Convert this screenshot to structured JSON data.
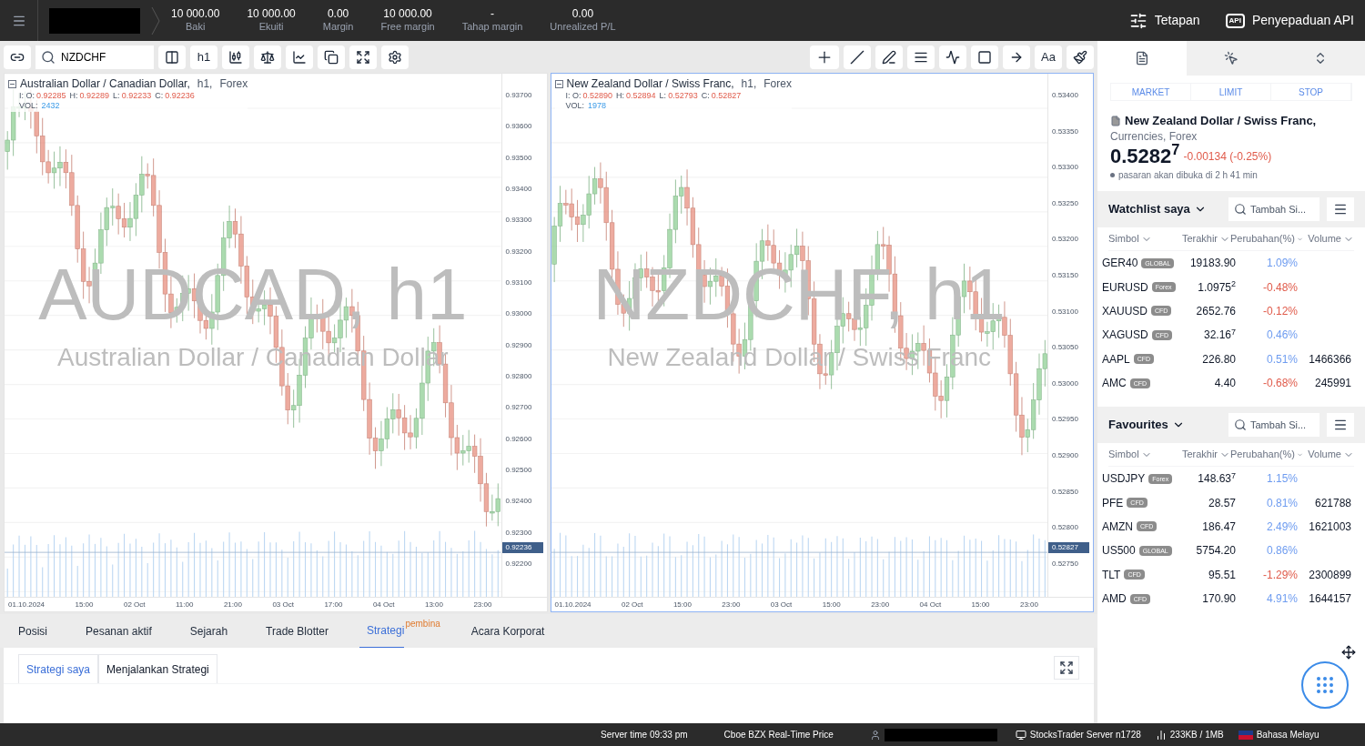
{
  "top_bar": {
    "stats": [
      {
        "value": "10 000.00",
        "label": "Baki"
      },
      {
        "value": "10 000.00",
        "label": "Ekuiti"
      },
      {
        "value": "0.00",
        "label": "Margin"
      },
      {
        "value": "10 000.00",
        "label": "Free margin"
      },
      {
        "value": "-",
        "label": "Tahap margin"
      },
      {
        "value": "0.00",
        "label": "Unrealized P/L"
      }
    ],
    "settings": "Tetapan",
    "api_badge": "API",
    "api": "Penyepaduan API"
  },
  "toolbar": {
    "symbol": "NZDCHF",
    "timeframe": "h1",
    "text_tool": "Aa"
  },
  "charts": [
    {
      "selected": false,
      "title": "Australian Dollar / Canadian Dollar,",
      "meta": [
        "h1,",
        "Forex"
      ],
      "ohlc": [
        {
          "label": "I: O:",
          "value": "0.92285"
        },
        {
          "label": "H:",
          "value": "0.92289"
        },
        {
          "label": "L:",
          "value": "0.92233"
        },
        {
          "label": "C:",
          "value": "0.92236"
        }
      ],
      "vol_label": "VOL:",
      "vol": "2432",
      "watermark": "AUDCAD, h1",
      "watermark_name": "Australian Dollar / Canadian Dollar",
      "price_ticks": [
        "0.93700",
        "0.93600",
        "0.93500",
        "0.93400",
        "0.93300",
        "0.93200",
        "0.93100",
        "0.93000",
        "0.92900",
        "0.92800",
        "0.92700",
        "0.92600",
        "0.92500",
        "0.92400",
        "0.92300",
        "0.92200"
      ],
      "last_price": "0.92236",
      "time_ticks": [
        "01.10.2024",
        "15:00",
        "02 Oct",
        "11:00",
        "21:00",
        "03 Oct",
        "17:00",
        "04 Oct",
        "13:00",
        "23:00"
      ]
    },
    {
      "selected": true,
      "title": "New Zealand Dollar / Swiss Franc,",
      "meta": [
        "h1,",
        "Forex"
      ],
      "ohlc": [
        {
          "label": "I: O:",
          "value": "0.52890"
        },
        {
          "label": "H:",
          "value": "0.52894"
        },
        {
          "label": "L:",
          "value": "0.52793"
        },
        {
          "label": "C:",
          "value": "0.52827"
        }
      ],
      "vol_label": "VOL:",
      "vol": "1978",
      "watermark": "NZDCHF, h1",
      "watermark_name": "New Zealand Dollar / Swiss Franc",
      "price_ticks": [
        "0.53400",
        "0.53350",
        "0.53300",
        "0.53250",
        "0.53200",
        "0.53150",
        "0.53100",
        "0.53050",
        "0.53000",
        "0.52950",
        "0.52900",
        "0.52850",
        "0.52800",
        "0.52750"
      ],
      "last_price": "0.52827",
      "time_ticks": [
        "01.10.2024",
        "02 Oct",
        "15:00",
        "23:00",
        "03 Oct",
        "15:00",
        "23:00",
        "04 Oct",
        "15:00",
        "23:00"
      ]
    }
  ],
  "bottom_panel": {
    "tabs": [
      {
        "label": "Posisi",
        "selected": false
      },
      {
        "label": "Pesanan aktif",
        "selected": false
      },
      {
        "label": "Sejarah",
        "selected": false
      },
      {
        "label": "Trade Blotter",
        "selected": false
      },
      {
        "label": "Strategi",
        "selected": true,
        "badge": "pembina"
      },
      {
        "label": "Acara Korporat",
        "selected": false
      }
    ],
    "subtabs": [
      {
        "label": "Strategi saya",
        "selected": true
      },
      {
        "label": "Menjalankan Strategi",
        "selected": false
      }
    ]
  },
  "side_panel": {
    "order_types": [
      "MARKET",
      "LIMIT",
      "STOP"
    ],
    "instrument": {
      "name": "New Zealand Dollar / Swiss Franc,",
      "category": "Currencies, Forex",
      "price": "0.5282$^{7}$",
      "change": "-0.00134 (-0.25%)",
      "status": "pasaran akan dibuka di 2 h 41 min"
    },
    "lists": [
      {
        "title": "Watchlist saya",
        "search_placeholder": "Tambah Si...",
        "columns": [
          "Simbol",
          "Terakhir",
          "Perubahan(%)",
          "Volume"
        ],
        "rows": [
          {
            "symbol": "GER40",
            "tag": "GLOBAL",
            "last": "19183.90",
            "change": "1.09%",
            "color": "#6e9cf0"
          },
          {
            "symbol": "EURUSD",
            "tag": "Forex",
            "last": "1.0975$^{2}$",
            "change": "-0.48%",
            "color": "#e05b4b"
          },
          {
            "symbol": "XAUUSD",
            "tag": "CFD",
            "last": "2652.76",
            "change": "-0.12%",
            "color": "#e05b4b"
          },
          {
            "symbol": "XAGUSD",
            "tag": "CFD",
            "last": "32.16$^{7}$",
            "change": "0.46%",
            "color": "#6e9cf0"
          },
          {
            "symbol": "AAPL",
            "tag": "CFD",
            "last": "226.80",
            "change": "0.51%",
            "color": "#6e9cf0",
            "volume": "1466366"
          },
          {
            "symbol": "AMC",
            "tag": "CFD",
            "last": "4.40",
            "change": "-0.68%",
            "color": "#e05b4b",
            "volume": "245991"
          }
        ]
      },
      {
        "title": "Favourites",
        "search_placeholder": "Tambah Si...",
        "columns": [
          "Simbol",
          "Terakhir",
          "Perubahan(%)",
          "Volume"
        ],
        "rows": [
          {
            "symbol": "USDJPY",
            "tag": "Forex",
            "last": "148.63$^{7}$",
            "change": "1.15%",
            "color": "#6e9cf0"
          },
          {
            "symbol": "PFE",
            "tag": "CFD",
            "last": "28.57",
            "change": "0.81%",
            "color": "#6e9cf0",
            "volume": "621788"
          },
          {
            "symbol": "AMZN",
            "tag": "CFD",
            "last": "186.47",
            "change": "2.49%",
            "color": "#6e9cf0",
            "volume": "1621003"
          },
          {
            "symbol": "US500",
            "tag": "GLOBAL",
            "last": "5754.20",
            "change": "0.86%",
            "color": "#6e9cf0"
          },
          {
            "symbol": "TLT",
            "tag": "CFD",
            "last": "95.51",
            "change": "-1.29%",
            "color": "#e05b4b",
            "volume": "2300899"
          },
          {
            "symbol": "AMD",
            "tag": "CFD",
            "last": "170.90",
            "change": "4.91%",
            "color": "#6e9cf0",
            "volume": "1644157"
          }
        ]
      }
    ]
  },
  "status_bar": {
    "server_time": "Server time 09:33 pm",
    "feed": "Cboe BZX Real-Time Price",
    "server": "StocksTrader Server n1728",
    "traffic": "233KB / 1MB",
    "language": "Bahasa Melayu"
  }
}
